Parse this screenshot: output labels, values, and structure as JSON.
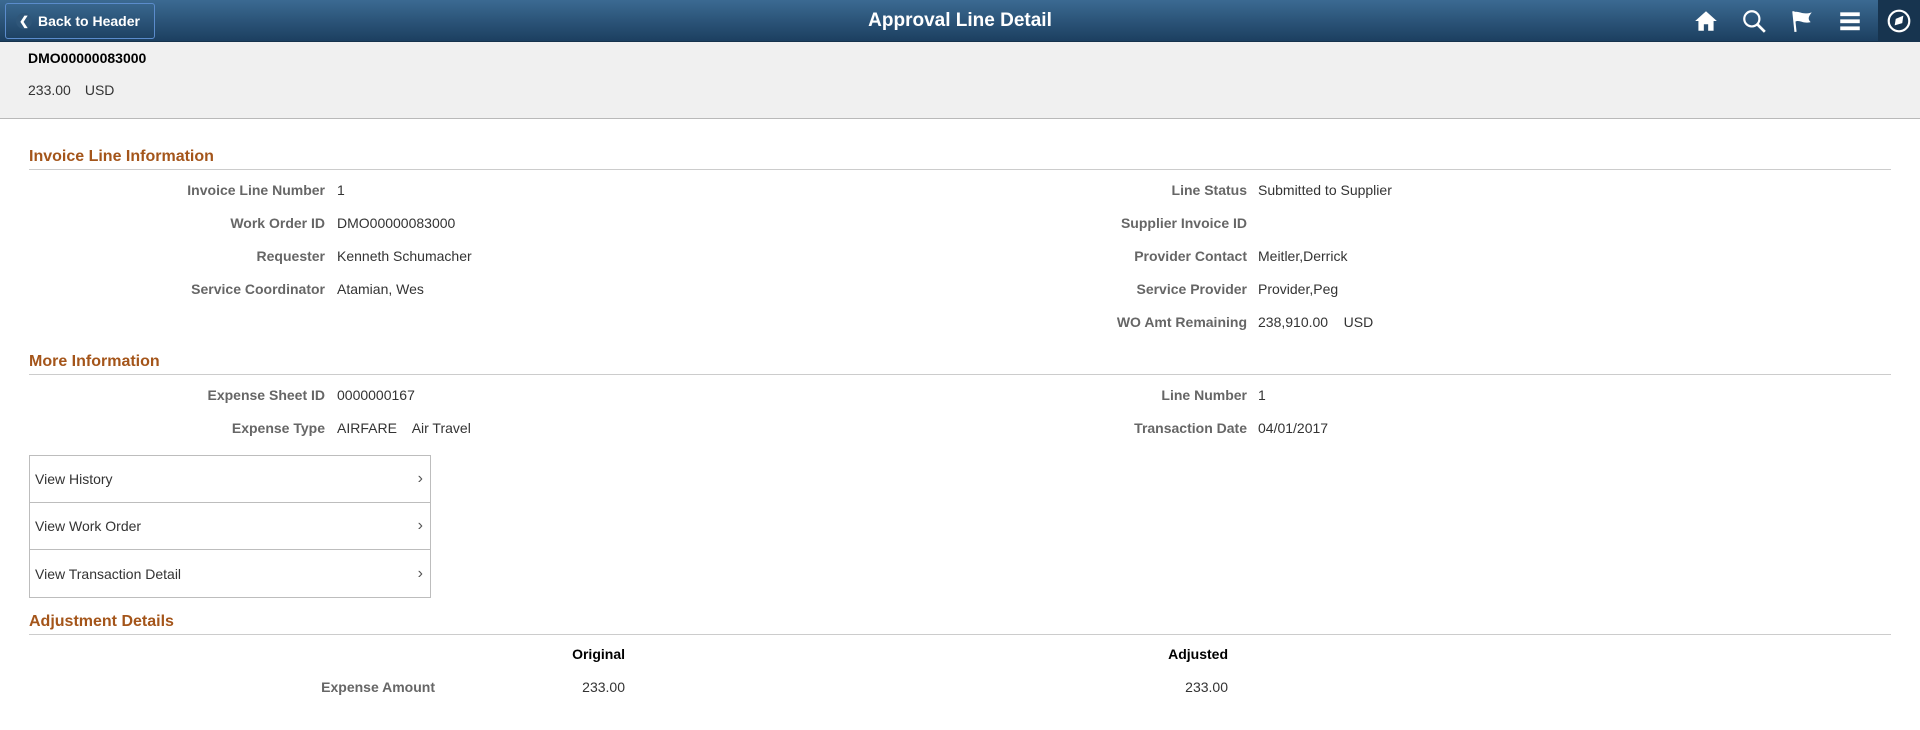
{
  "banner": {
    "back_label": "Back to Header",
    "title": "Approval Line Detail",
    "icons": [
      "home-icon",
      "search-icon",
      "flag-icon",
      "menu-icon",
      "navbar-icon"
    ]
  },
  "summary": {
    "work_order_id": "DMO00000083000",
    "amount": "233.00",
    "currency": "USD"
  },
  "invoice_line": {
    "title": "Invoice Line Information",
    "left": [
      {
        "label": "Invoice Line Number",
        "value": "1"
      },
      {
        "label": "Work Order ID",
        "value": "DMO00000083000"
      },
      {
        "label": "Requester",
        "value": "Kenneth Schumacher"
      },
      {
        "label": "Service Coordinator",
        "value": "Atamian, Wes"
      }
    ],
    "right": [
      {
        "label": "Line Status",
        "value": "Submitted to Supplier"
      },
      {
        "label": "Supplier Invoice ID",
        "value": ""
      },
      {
        "label": "Provider Contact",
        "value": "Meitler,Derrick"
      },
      {
        "label": "Service Provider",
        "value": "Provider,Peg"
      },
      {
        "label": "WO Amt Remaining",
        "value": "238,910.00    USD"
      }
    ]
  },
  "more_info": {
    "title": "More Information",
    "left": [
      {
        "label": "Expense Sheet ID",
        "value": "0000000167"
      },
      {
        "label": "Expense Type",
        "value": "AIRFARE    Air Travel"
      }
    ],
    "right": [
      {
        "label": "Line Number",
        "value": "1"
      },
      {
        "label": "Transaction Date",
        "value": "04/01/2017"
      }
    ]
  },
  "links": [
    {
      "label": "View History"
    },
    {
      "label": "View Work Order"
    },
    {
      "label": "View Transaction Detail"
    }
  ],
  "adjustment": {
    "title": "Adjustment Details",
    "col_original": "Original",
    "col_adjusted": "Adjusted",
    "rows": [
      {
        "label": "Expense Amount",
        "original": "233.00",
        "adjusted": "233.00"
      }
    ]
  }
}
